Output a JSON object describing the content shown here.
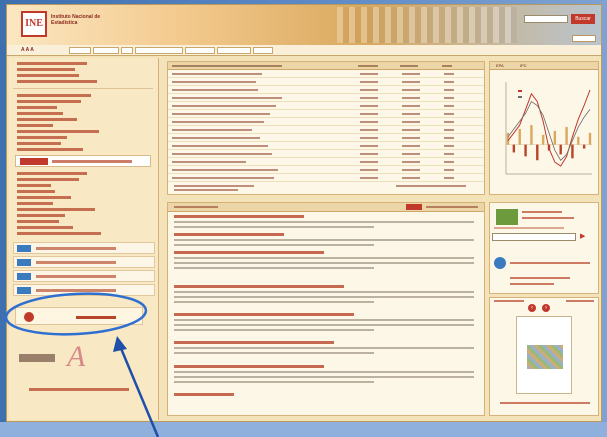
{
  "header": {
    "logo_text": "INE",
    "org_name": "Instituto Nacional de Estadística",
    "search_button": "Buscar"
  },
  "chart": {
    "tabs": [
      "EPA",
      "IPC"
    ]
  },
  "colors": {
    "brand_red": "#c0392b",
    "page_beige": "#f4e2b8",
    "annotation_blue": "#2f6fd0",
    "backdrop_blue": "#4a78b8"
  },
  "icons": {
    "search": "search-icon",
    "arrow": "arrow-annotation"
  },
  "chart_data": {
    "type": "line",
    "series": [
      {
        "values": [
          0.2,
          0.6,
          1.0,
          1.8,
          2.6,
          2.2,
          1.2,
          -0.2,
          -0.9,
          -1.1,
          -0.6,
          0.4,
          1.3,
          2.0,
          2.8
        ]
      },
      {
        "values": [
          0.4,
          0.8,
          1.2,
          1.6,
          2.2,
          2.0,
          1.5,
          0.6,
          -0.3,
          -0.8,
          -0.5,
          0.2,
          0.9,
          1.4,
          1.8
        ]
      }
    ],
    "bars": [
      0.6,
      -0.4,
      0.8,
      -0.6,
      1.0,
      -0.8,
      0.5,
      -0.3,
      0.7,
      -0.5,
      0.9,
      -0.7,
      0.4,
      -0.2,
      0.6
    ]
  }
}
